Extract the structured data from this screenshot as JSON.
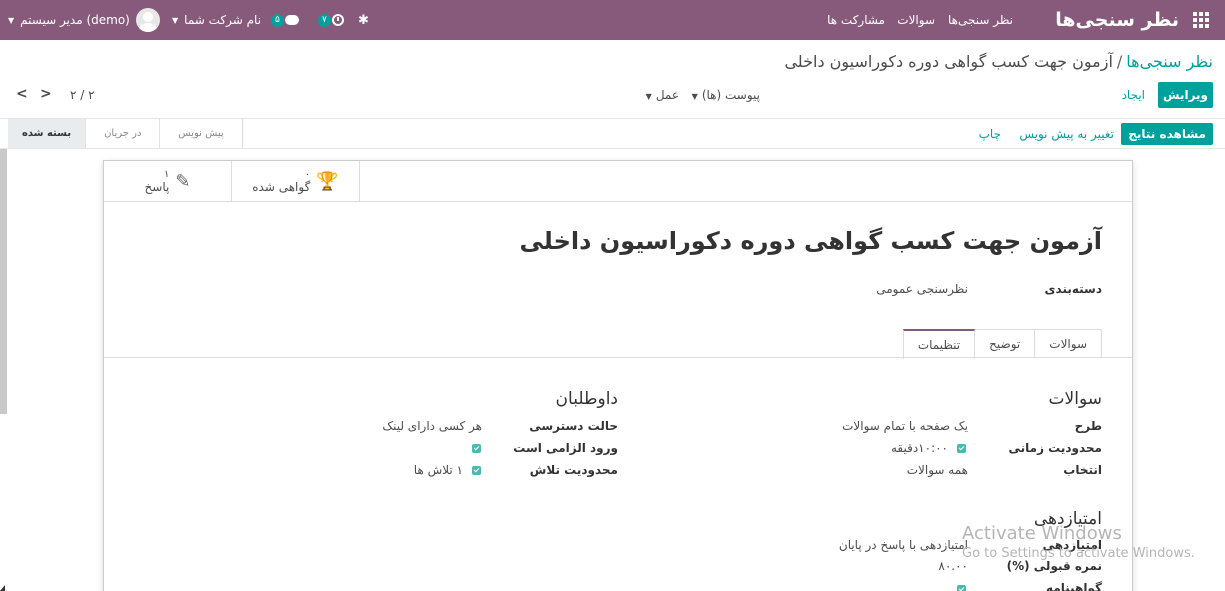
{
  "navbar": {
    "app_title": "نظر سنجی‌ها",
    "menu": [
      "نظر سنجی‌ها",
      "سوالات",
      "مشارکت ها"
    ],
    "activity_count": "۷",
    "messages_count": "۵",
    "company": "نام شرکت شما",
    "user": "مدیر سیستم (demo)",
    "icons": [
      "apps-grid-icon",
      "bug-icon",
      "clock-icon",
      "chat-icon",
      "avatar"
    ],
    "color": "#875a7b"
  },
  "control_panel": {
    "breadcrumb_parent": "نظر سنجی‌ها",
    "breadcrumb_sep": "/",
    "breadcrumb_current": "آزمون جهت کسب گواهی دوره دکوراسیون داخلی",
    "edit_label": "ویرایش",
    "create_label": "ایجاد",
    "attachments_label": "پیوست (ها)",
    "action_label": "عمل",
    "pager": "۲ / ۲"
  },
  "statusbar": {
    "results_label": "مشاهده نتایج",
    "to_draft_label": "تغییر به پیش نویس",
    "print_label": "چاپ",
    "stages": [
      "پیش نویس",
      "در جریان",
      "بسته شده"
    ],
    "active_stage": "بسته شده"
  },
  "button_box": [
    {
      "icon": "edit-icon",
      "value": "۱",
      "label": "پاسخ"
    },
    {
      "icon": "trophy-icon",
      "value": "۰",
      "label": "گواهی شده"
    }
  ],
  "form": {
    "title": "آزمون جهت کسب گواهی دوره دکوراسیون داخلی",
    "category_label": "دسته‌بندی",
    "category_value": "نظرسنجی عمومی",
    "tabs": [
      "سوالات",
      "توضیح",
      "تنظیمات"
    ],
    "active_tab": "تنظیمات",
    "questions_section": {
      "title": "سوالات",
      "layout_label": "طرح",
      "layout_value": "یک صفحه با تمام سوالات",
      "time_limit_label": "محدودیت زمانی",
      "time_limit_checked": true,
      "time_limit_value": "۱۰:۰۰دقیقه",
      "selection_label": "انتخاب",
      "selection_value": "همه سوالات"
    },
    "participants_section": {
      "title": "داوطلبان",
      "access_label": "حالت دسترسی",
      "access_value": "هر کسی دارای لینک",
      "login_required_label": "ورود الزامی است",
      "login_required_checked": true,
      "attempts_limit_label": "محدودیت تلاش",
      "attempts_limit_checked": true,
      "attempts_value": "۱ تلاش ها"
    },
    "scoring_section": {
      "title": "امتیازدهی",
      "scoring_label": "امتیازدهی",
      "scoring_value": "امتیازدهی با پاسخ در پایان",
      "pass_label": "نمره قبولی (%)",
      "pass_value": "۸۰.۰۰",
      "certification_label": "گواهینامه"
    }
  },
  "watermark": {
    "line1": "Activate Windows",
    "line2": "Go to Settings to activate Windows."
  }
}
